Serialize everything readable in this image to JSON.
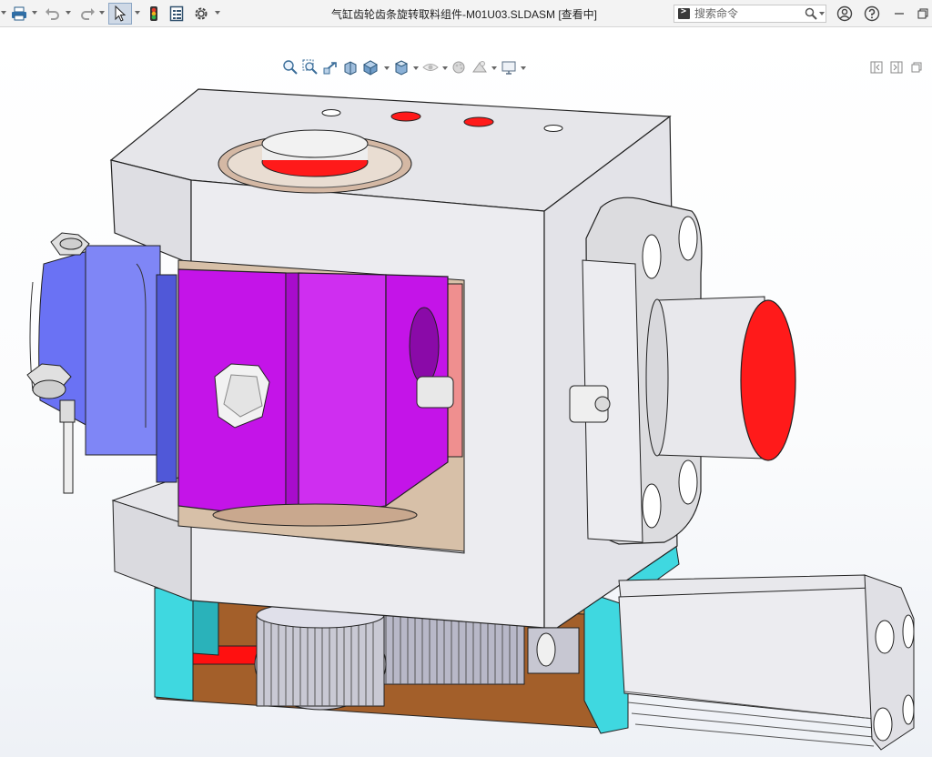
{
  "window": {
    "title": "气缸齿轮齿条旋转取料组件-M01U03.SLDASM [查看中]"
  },
  "toolbar": {
    "items": [
      {
        "name": "print-icon"
      },
      {
        "name": "undo-icon"
      },
      {
        "name": "redo-icon"
      },
      {
        "name": "select-arrow-icon"
      },
      {
        "name": "traffic-light-icon"
      },
      {
        "name": "file-properties-icon"
      },
      {
        "name": "gear-icon"
      }
    ]
  },
  "search": {
    "placeholder": "搜索命令"
  },
  "right_icons": [
    "user-icon",
    "help-icon",
    "minimize-icon",
    "restore-icon",
    "close-icon"
  ],
  "heads_up_toolbar": {
    "items": [
      "zoom-to-fit-icon",
      "zoom-to-area-icon",
      "previous-view-icon",
      "section-view-icon",
      "view-orientation-icon",
      "display-style-icon",
      "hide-show-items-icon",
      "edit-appearance-icon",
      "apply-scene-icon",
      "view-settings-icon"
    ]
  },
  "colors": {
    "housing": "#e6e6ea",
    "block": "#c414e8",
    "motor": "#6670f2",
    "bracket": "#3fd8e0",
    "rail": "#9a5a28",
    "red": "#ff1a1a"
  }
}
